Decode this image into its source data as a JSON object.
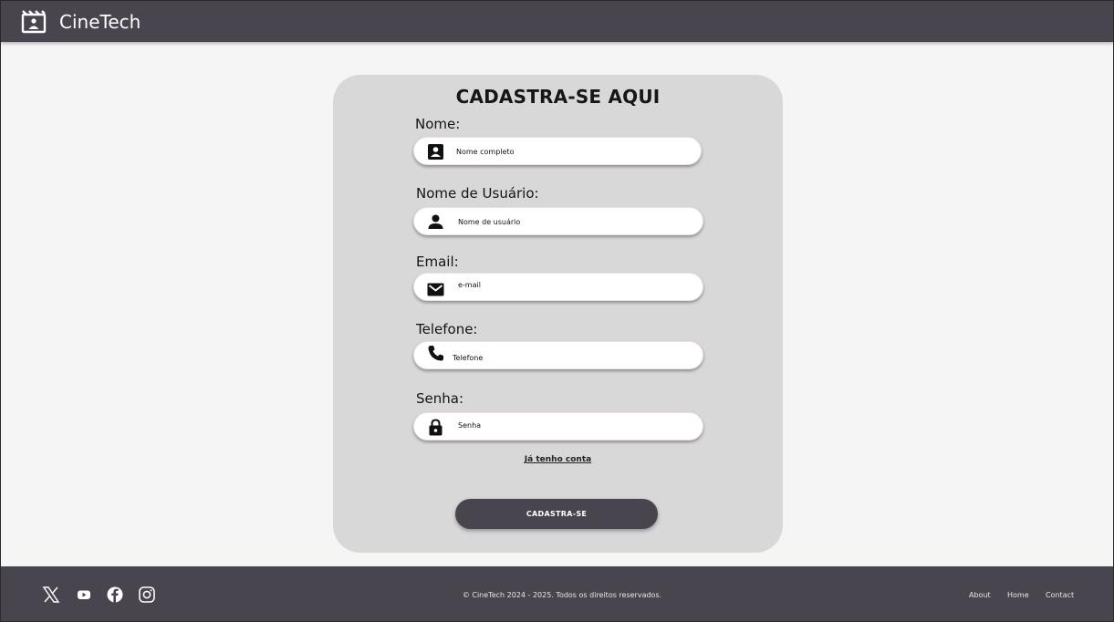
{
  "header": {
    "brand_name": "CineTech",
    "logo_icon": "clapperboard-icon"
  },
  "form": {
    "title": "CADASTRA-SE AQUI",
    "fields": [
      {
        "label": "Nome:",
        "placeholder": "Nome completo",
        "icon": "contact-card-icon"
      },
      {
        "label": "Nome de Usuário:",
        "placeholder": "Nome de usuário",
        "icon": "user-icon"
      },
      {
        "label": "Email:",
        "placeholder": "e-mail",
        "icon": "mail-icon"
      },
      {
        "label": "Telefone:",
        "placeholder": "Telefone",
        "icon": "phone-icon"
      },
      {
        "label": "Senha:",
        "placeholder": "Senha",
        "icon": "lock-icon"
      }
    ],
    "login_link": "Já tenho conta",
    "submit_label": "CADASTRA-SE"
  },
  "footer": {
    "social_icons": [
      "x-icon",
      "youtube-icon",
      "facebook-icon",
      "instagram-icon"
    ],
    "copyright": "© CineTech 2024 - 2025. Todos os direitos reservados.",
    "links": [
      "About",
      "Home",
      "Contact"
    ]
  },
  "colors": {
    "bar": "#48454e",
    "card": "#d8d8d8",
    "page": "#f5f5f5"
  }
}
